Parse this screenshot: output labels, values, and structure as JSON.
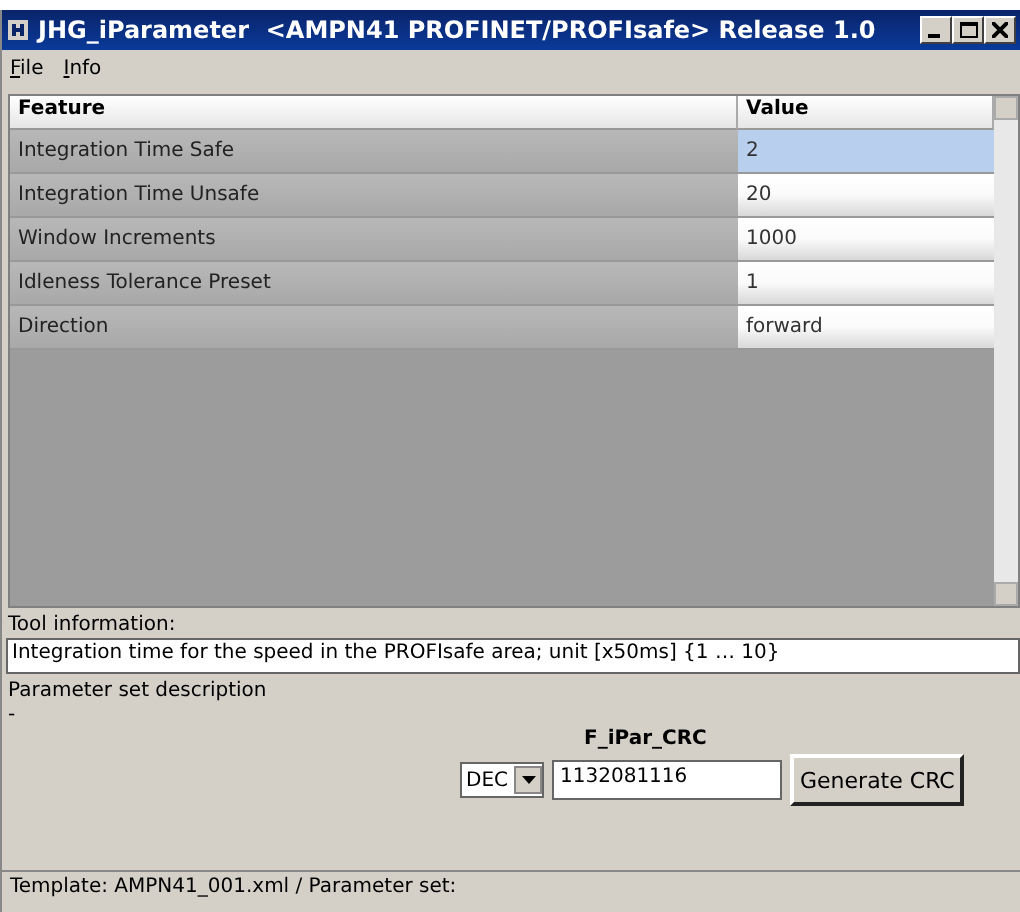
{
  "window": {
    "title": "JHG_iParameter  <AMPN41 PROFINET/PROFIsafe> Release 1.0"
  },
  "menu": [
    {
      "label": "File"
    },
    {
      "label": "Info"
    }
  ],
  "table": {
    "columns": [
      "Feature",
      "Value"
    ],
    "rows": [
      {
        "feature": "Integration Time Safe",
        "value": "2",
        "selected": true
      },
      {
        "feature": "Integration Time Unsafe",
        "value": "20",
        "selected": false
      },
      {
        "feature": "Window Increments",
        "value": "1000",
        "selected": false
      },
      {
        "feature": "Idleness Tolerance Preset",
        "value": "1",
        "selected": false
      },
      {
        "feature": "Direction",
        "value": "forward",
        "selected": false
      }
    ]
  },
  "tool_information": {
    "label": "Tool information:",
    "value": "Integration time for the speed in the PROFIsafe area; unit [x50ms] {1 … 10}"
  },
  "parameter_set": {
    "label": "Parameter set description",
    "value": "-"
  },
  "crc": {
    "label": "F_iPar_CRC",
    "format": "DEC",
    "value": "1132081116",
    "button": "Generate CRC"
  },
  "status_bar": "Template: AMPN41_001.xml  /  Parameter set:"
}
